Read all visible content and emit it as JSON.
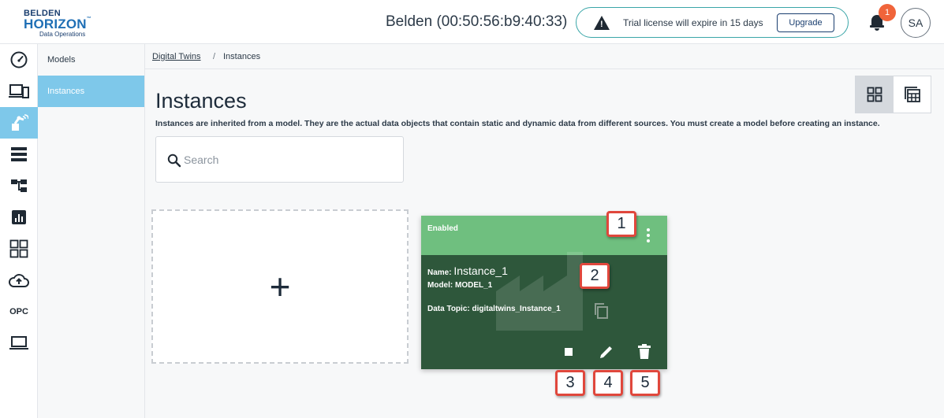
{
  "header": {
    "logo": {
      "brand": "BELDEN",
      "product": "HORIZON",
      "trademark": "™",
      "tagline": "Data Operations"
    },
    "device_title": "Belden (00:50:56:b9:40:33)",
    "license": {
      "icon": "warning-icon",
      "message": "Trial license will expire in 15 days",
      "upgrade_label": "Upgrade",
      "border_color": "#3aa6a8"
    },
    "notifications": {
      "icon": "bell-icon",
      "count": "1",
      "badge_color": "#f0643a"
    },
    "avatar_initials": "SA"
  },
  "rail": {
    "items": [
      {
        "icon": "dashboard-gauge-icon",
        "active": false
      },
      {
        "icon": "devices-icon",
        "active": false
      },
      {
        "icon": "digital-twins-icon",
        "active": true
      },
      {
        "icon": "list-icon",
        "active": false
      },
      {
        "icon": "flow-icon",
        "active": false
      },
      {
        "icon": "analytics-icon",
        "active": false
      },
      {
        "icon": "apps-grid-icon",
        "active": false
      },
      {
        "icon": "cloud-upload-icon",
        "active": false
      },
      {
        "label": "OPC",
        "active": false
      },
      {
        "icon": "laptop-icon",
        "active": false
      }
    ],
    "active_color": "#7ec8ea"
  },
  "subnav": {
    "items": [
      {
        "label": "Models",
        "active": false
      },
      {
        "label": "Instances",
        "active": true
      }
    ]
  },
  "breadcrumb": {
    "parent": "Digital Twins",
    "separator": "/",
    "current": "Instances"
  },
  "page": {
    "title": "Instances",
    "description": "Instances are inherited from a model. They are the actual data objects that contain static and dynamic data from different sources. You must create a model before creating an instance.",
    "view_toggle": {
      "grid_icon": "grid-view-icon",
      "table_icon": "table-view-icon",
      "selected": "grid"
    }
  },
  "search": {
    "placeholder": "Search",
    "value": ""
  },
  "add_card": {
    "symbol": "+"
  },
  "instance_card": {
    "status": "Enabled",
    "name_label": "Name:",
    "name": "Instance_1",
    "model_label": "Model:",
    "model": "MODEL_1",
    "topic_label": "Data Topic:",
    "topic": "digitaltwins_Instance_1",
    "header_color": "#6fbf7f",
    "body_color": "#2e573b",
    "actions": [
      "stop-icon",
      "edit-icon",
      "delete-icon"
    ]
  },
  "callouts": [
    "1",
    "2",
    "3",
    "4",
    "5"
  ],
  "callout_color": "#e0473c"
}
